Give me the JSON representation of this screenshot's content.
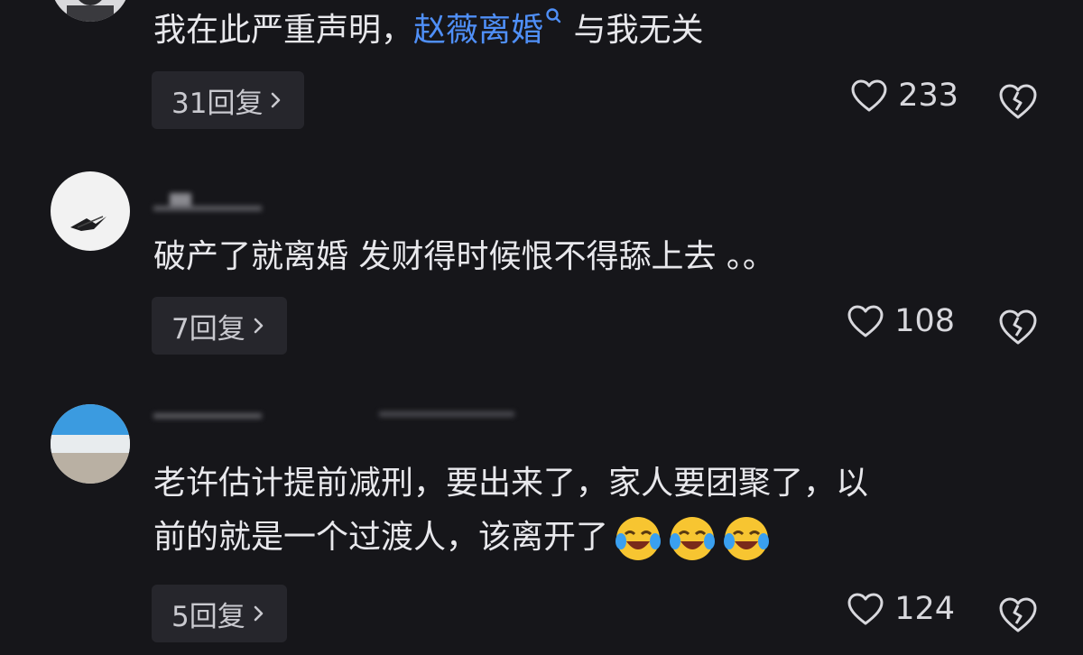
{
  "comments": [
    {
      "text_before": "我在此严重声明，",
      "keyword": "赵薇离婚",
      "text_after": " 与我无关",
      "replies": "31回复",
      "likes": "233",
      "avatar_icon": "avatar-man-icon"
    },
    {
      "text": "破产了就离婚 发财得时候恨不得舔上去 。。",
      "replies": "7回复",
      "likes": "108",
      "avatar_icon": "avatar-feather-icon"
    },
    {
      "line1": "老许估计提前减刑，要出来了，家人要团聚了，以",
      "line2": "前的就是一个过渡人，该离开了",
      "emoji": [
        "laughing-crying-emoji",
        "laughing-crying-emoji",
        "laughing-crying-emoji"
      ],
      "replies": "5回复",
      "likes": "124",
      "avatar_icon": "avatar-beach-icon"
    }
  ],
  "colors": {
    "background": "#16161a",
    "keyword": "#4f8ff7",
    "reply_pill": "#26262c"
  },
  "icons": {
    "like": "heart-outline-icon",
    "dislike": "broken-heart-icon",
    "chevron": "chevron-right-icon",
    "search": "search-icon"
  }
}
